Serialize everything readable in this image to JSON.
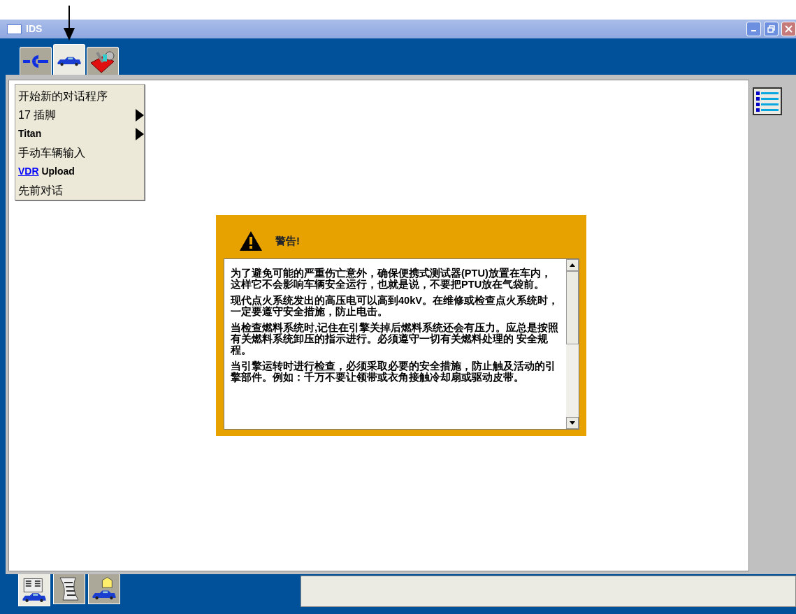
{
  "window": {
    "title": "IDS"
  },
  "top_tabs": [
    {
      "selected": false
    },
    {
      "selected": true
    },
    {
      "selected": false
    }
  ],
  "menu": [
    {
      "kind": "item",
      "label": "开始新的对话程序"
    },
    {
      "kind": "submenu",
      "label": "17 插脚"
    },
    {
      "kind": "submenu",
      "label": "Titan"
    },
    {
      "kind": "item",
      "label": "手动车辆输入"
    },
    {
      "kind": "link",
      "link": "VDR",
      "label": "Upload"
    },
    {
      "kind": "item",
      "label": "先前对话"
    }
  ],
  "warning": {
    "title": "警告!",
    "paragraphs": [
      "为了避免可能的严重伤亡意外，确保便携式测试器(PTU)放置在车内，这样它不会影响车辆安全运行，也就是说，不要把PTU放在气袋前。",
      "现代点火系统发出的高压电可以高到40kV。在维修或检查点火系统时，一定要遵守安全措施，防止电击。",
      "当检查燃料系统时,记住在引擎关掉后燃料系统还会有压力。应总是按照有关燃料系统卸压的指示进行。必须遵守一切有关燃料处理的 安全规程。",
      "当引擎运转时进行检查，必须采取必要的安全措施，防止触及活动的引擎部件。例如：千万不要让领带或衣角接触冷却扇或驱动皮带。"
    ]
  },
  "bottom_tabs": [
    {
      "selected": true
    },
    {
      "selected": false
    },
    {
      "selected": false
    }
  ]
}
